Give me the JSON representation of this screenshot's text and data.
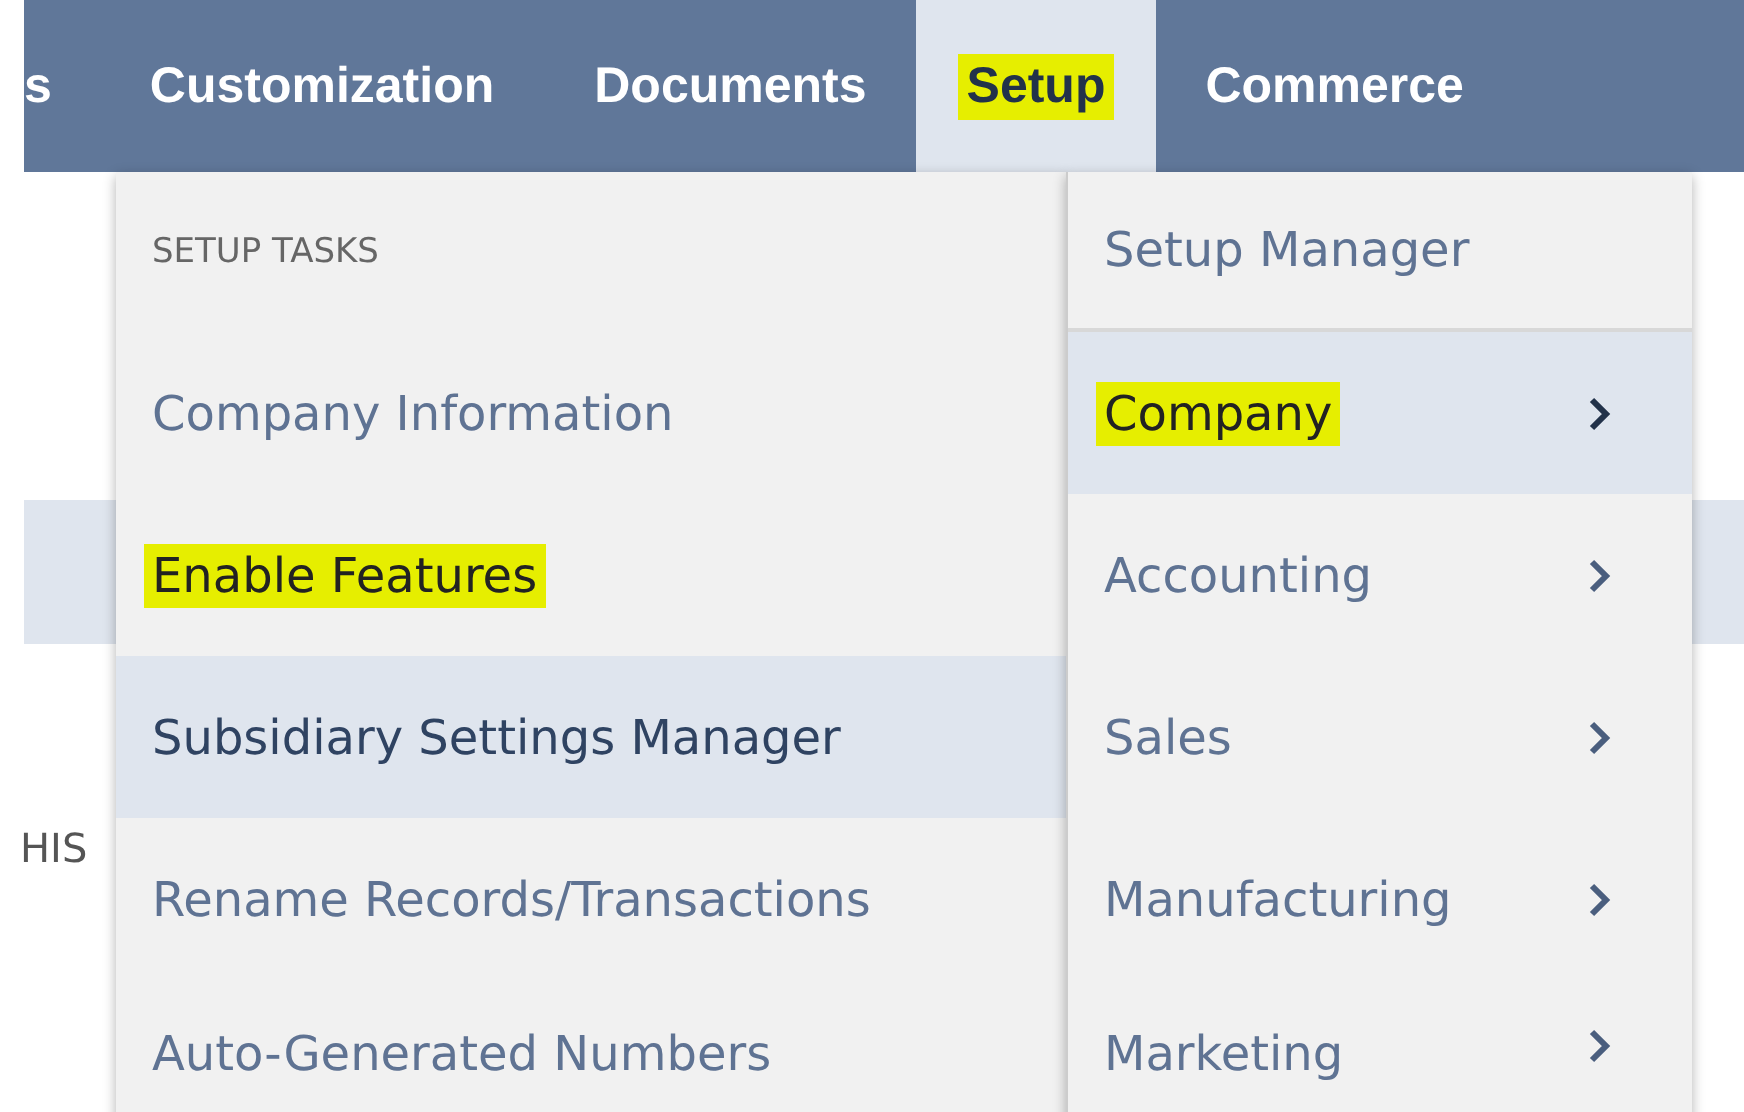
{
  "nav": [
    {
      "label": "s",
      "selected": false,
      "highlighted": false
    },
    {
      "label": "Customization",
      "selected": false,
      "highlighted": false
    },
    {
      "label": "Documents",
      "selected": false,
      "highlighted": false
    },
    {
      "label": "Setup",
      "selected": true,
      "highlighted": true
    },
    {
      "label": "Commerce",
      "selected": false,
      "highlighted": false
    }
  ],
  "page_text": "HIS",
  "tasks_menu": {
    "heading": "SETUP TASKS",
    "items": [
      {
        "label": "Company Information",
        "selected": false,
        "highlighted": false
      },
      {
        "label": "Enable Features",
        "selected": false,
        "highlighted": true
      },
      {
        "label": "Subsidiary Settings Manager",
        "selected": true,
        "highlighted": false
      },
      {
        "label": "Rename Records/Transactions",
        "selected": false,
        "highlighted": false
      },
      {
        "label": "Auto-Generated Numbers",
        "selected": false,
        "highlighted": false
      }
    ]
  },
  "setup_menu": {
    "items": [
      {
        "label": "Setup Manager",
        "selected": false,
        "highlighted": false,
        "submenu": false
      },
      {
        "label": "Company",
        "selected": true,
        "highlighted": true,
        "submenu": true
      },
      {
        "label": "Accounting",
        "selected": false,
        "highlighted": false,
        "submenu": true
      },
      {
        "label": "Sales",
        "selected": false,
        "highlighted": false,
        "submenu": true
      },
      {
        "label": "Manufacturing",
        "selected": false,
        "highlighted": false,
        "submenu": true
      },
      {
        "label": "Marketing",
        "selected": false,
        "highlighted": false,
        "submenu": true
      }
    ]
  }
}
